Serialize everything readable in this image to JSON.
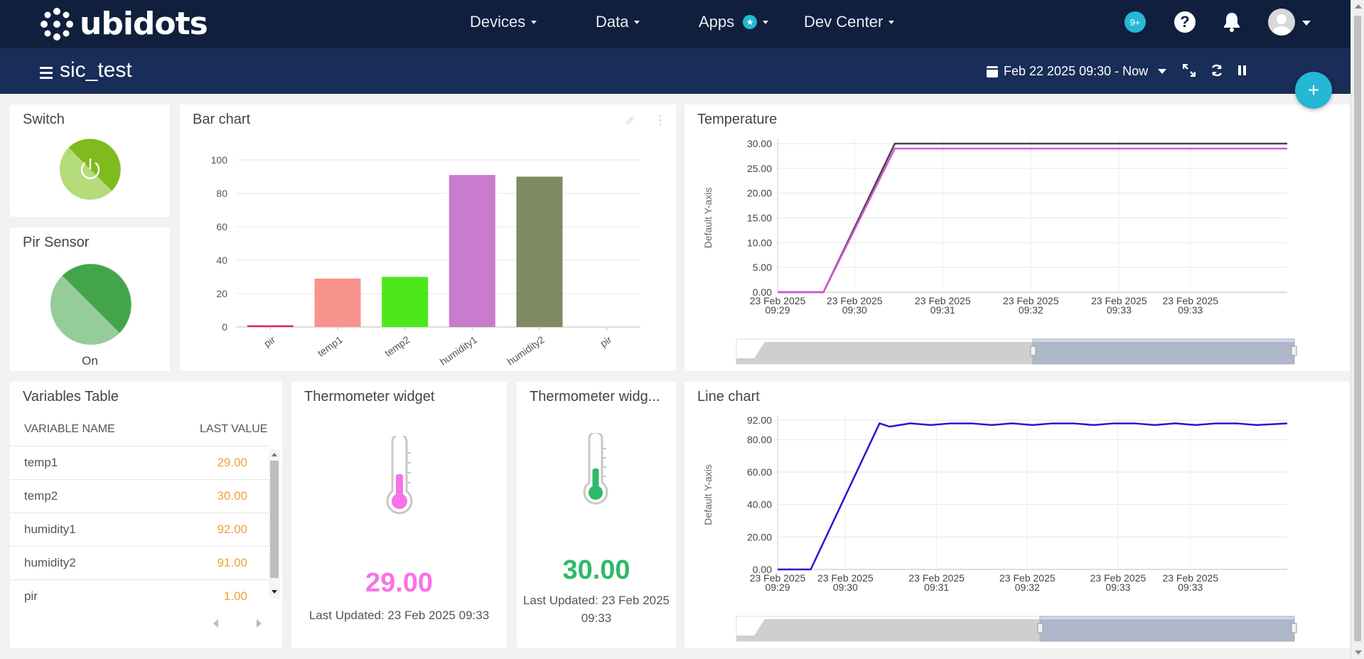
{
  "nav": {
    "brand": "ubidots",
    "devices": "Devices",
    "data": "Data",
    "apps": "Apps",
    "dev_center": "Dev Center",
    "badge": "9+",
    "help": "?"
  },
  "header": {
    "dashboard_name": "sic_test",
    "date_range": "Feb 22 2025 09:30 - Now",
    "add": "+"
  },
  "switch_widget": {
    "title": "Switch"
  },
  "pir_widget": {
    "title": "Pir Sensor",
    "state": "On"
  },
  "bar_chart_widget": {
    "title": "Bar chart"
  },
  "temperature_widget": {
    "title": "Temperature"
  },
  "line_chart_widget": {
    "title": "Line chart"
  },
  "variables_table": {
    "title": "Variables Table",
    "col_name": "VARIABLE NAME",
    "col_value": "LAST VALUE",
    "rows": [
      {
        "name": "temp1",
        "value": "29.00"
      },
      {
        "name": "temp2",
        "value": "30.00"
      },
      {
        "name": "humidity1",
        "value": "92.00"
      },
      {
        "name": "humidity2",
        "value": "91.00"
      },
      {
        "name": "pir",
        "value": "1.00"
      }
    ]
  },
  "thermo1": {
    "title": "Thermometer widget",
    "value": "29.00",
    "updated": "Last Updated: 23 Feb 2025 09:33",
    "color": "#f772e8"
  },
  "thermo2": {
    "title": "Thermometer widg...",
    "value": "30.00",
    "updated_line1": "Last Updated: 23 Feb 2025",
    "updated_line2": "09:33",
    "color": "#2fb96a"
  },
  "chart_data": [
    {
      "type": "bar",
      "title": "Bar chart",
      "categories": [
        "pir",
        "temp1",
        "temp2",
        "humidity1",
        "humidity2",
        "pir"
      ],
      "values": [
        1,
        29,
        30,
        91,
        90,
        0
      ],
      "colors": [
        "#e0245e",
        "#f7938c",
        "#4ce81c",
        "#c97bcd",
        "#7e8a62",
        "#cccccc"
      ],
      "yticks": [
        "0",
        "20",
        "40",
        "60",
        "80",
        "100"
      ],
      "ylim": [
        0,
        100
      ]
    },
    {
      "type": "line",
      "title": "Temperature",
      "ylabel": "Default Y-axis",
      "yticks": [
        "0.00",
        "5.00",
        "10.00",
        "15.00",
        "20.00",
        "25.00",
        "30.00"
      ],
      "ylim": [
        0,
        30
      ],
      "xticks": [
        [
          "23 Feb 2025",
          "09:29"
        ],
        [
          "23 Feb 2025",
          "09:30"
        ],
        [
          "23 Feb 2025",
          "09:31"
        ],
        [
          "23 Feb 2025",
          "09:32"
        ],
        [
          "23 Feb 2025",
          "09:33"
        ],
        [
          "23 Feb 2025",
          "09:33"
        ]
      ],
      "series": [
        {
          "color": "#444444",
          "points": [
            [
              0,
              0
            ],
            [
              0.09,
              0
            ],
            [
              0.23,
              30
            ],
            [
              1,
              30
            ]
          ]
        },
        {
          "color": "#d455d6",
          "points": [
            [
              0,
              0
            ],
            [
              0.09,
              0
            ],
            [
              0.23,
              29
            ],
            [
              1,
              29
            ]
          ]
        }
      ]
    },
    {
      "type": "line",
      "title": "Line chart",
      "ylabel": "Default Y-axis",
      "yticks": [
        "0.00",
        "20.00",
        "40.00",
        "60.00",
        "80.00",
        "92.00"
      ],
      "ytick_values": [
        0,
        20,
        40,
        60,
        80,
        92
      ],
      "ylim": [
        0,
        92
      ],
      "xticks": [
        [
          "23 Feb 2025",
          "09:29"
        ],
        [
          "23 Feb 2025",
          "09:30"
        ],
        [
          "23 Feb 2025",
          "09:31"
        ],
        [
          "23 Feb 2025",
          "09:32"
        ],
        [
          "23 Feb 2025",
          "09:33"
        ],
        [
          "23 Feb 2025",
          "09:33"
        ]
      ],
      "series": [
        {
          "color": "#2a14d6",
          "points": [
            [
              0,
              0
            ],
            [
              0.065,
              0
            ],
            [
              0.2,
              90
            ],
            [
              0.22,
              88
            ],
            [
              0.26,
              90
            ],
            [
              0.3,
              89
            ],
            [
              0.34,
              90
            ],
            [
              0.38,
              90
            ],
            [
              0.42,
              89
            ],
            [
              0.46,
              90
            ],
            [
              0.5,
              89
            ],
            [
              0.54,
              90
            ],
            [
              0.58,
              90
            ],
            [
              0.62,
              89
            ],
            [
              0.66,
              90
            ],
            [
              0.7,
              90
            ],
            [
              0.74,
              89
            ],
            [
              0.78,
              90
            ],
            [
              0.82,
              89
            ],
            [
              0.86,
              90
            ],
            [
              0.9,
              90
            ],
            [
              0.94,
              89
            ],
            [
              1,
              90
            ]
          ]
        }
      ]
    }
  ]
}
